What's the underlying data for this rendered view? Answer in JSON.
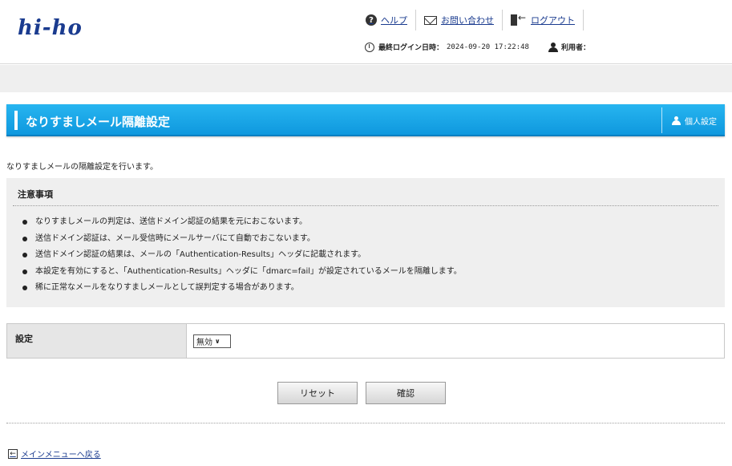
{
  "header": {
    "logo": "hi-ho",
    "links": {
      "help": "ヘルプ",
      "contact": "お問い合わせ",
      "logout": "ログアウト"
    },
    "last_login_label": "最終ログイン日時：",
    "last_login_value": "2024-09-20 17:22:48",
    "user_label": "利用者："
  },
  "title_bar": {
    "title": "なりすましメール隔離設定",
    "personal_settings": "個人設定"
  },
  "description": "なりすましメールの隔離設定を行います。",
  "notice": {
    "title": "注意事項",
    "items": [
      "なりすましメールの判定は、送信ドメイン認証の結果を元におこないます。",
      "送信ドメイン認証は、メール受信時にメールサーバにて自動でおこないます。",
      "送信ドメイン認証の結果は、メールの「Authentication-Results」ヘッダに記載されます。",
      "本設定を有効にすると、「Authentication-Results」ヘッダに「dmarc=fail」が設定されているメールを隔離します。",
      "稀に正常なメールをなりすましメールとして誤判定する場合があります。"
    ]
  },
  "settings": {
    "label": "設定",
    "select_value": "無効"
  },
  "buttons": {
    "reset": "リセット",
    "confirm": "確認"
  },
  "back_link": "メインメニューへ戻る"
}
